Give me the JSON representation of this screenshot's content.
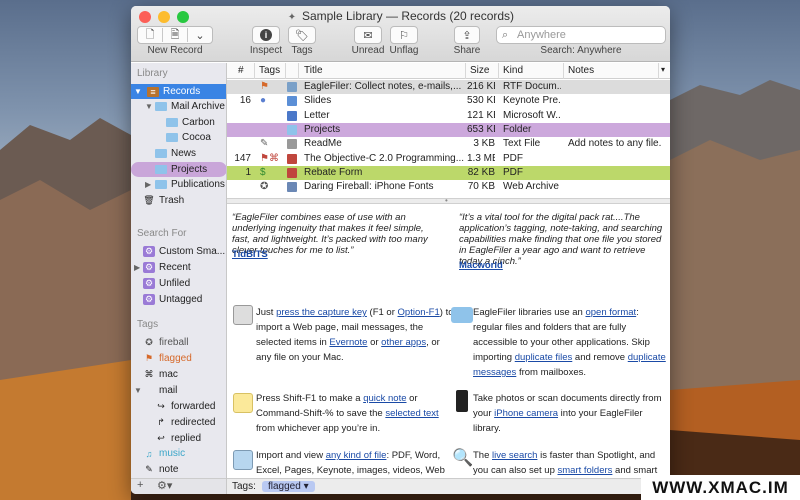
{
  "window": {
    "title": "Sample Library — Records (20 records)"
  },
  "toolbar": {
    "new_record_label": "New Record",
    "inspect_label": "Inspect",
    "tags_label": "Tags",
    "unread_label": "Unread",
    "unflag_label": "Unflag",
    "share_label": "Share",
    "search_placeholder": "Anywhere",
    "search_label": "Search: Anywhere"
  },
  "sidebar": {
    "library_header": "Library",
    "library_items": [
      {
        "label": "Records"
      },
      {
        "label": "Mail Archive"
      },
      {
        "label": "Carbon"
      },
      {
        "label": "Cocoa"
      },
      {
        "label": "News"
      },
      {
        "label": "Projects"
      },
      {
        "label": "Publications"
      },
      {
        "label": "Trash"
      }
    ],
    "search_header": "Search For",
    "search_items": [
      {
        "label": "Custom Sma..."
      },
      {
        "label": "Recent"
      },
      {
        "label": "Unfiled"
      },
      {
        "label": "Untagged"
      }
    ],
    "tags_header": "Tags",
    "tag_items": [
      {
        "label": "fireball"
      },
      {
        "label": "flagged"
      },
      {
        "label": "mac"
      },
      {
        "label": "mail"
      },
      {
        "label": "forwarded"
      },
      {
        "label": "redirected"
      },
      {
        "label": "replied"
      },
      {
        "label": "music"
      },
      {
        "label": "note"
      }
    ]
  },
  "table": {
    "columns": {
      "num": "#",
      "tags": "Tags",
      "title": "Title",
      "size": "Size",
      "kind": "Kind",
      "notes": "Notes"
    },
    "rows": [
      {
        "num": "",
        "tags": "⚑",
        "title": "EagleFiler: Collect notes, e-mails,...",
        "size": "216 KB",
        "kind": "RTF Docum...",
        "notes": ""
      },
      {
        "num": "16",
        "tags": "●",
        "title": "Slides",
        "size": "530 KB",
        "kind": "Keynote Pre...",
        "notes": ""
      },
      {
        "num": "",
        "tags": "",
        "title": "Letter",
        "size": "121 KB",
        "kind": "Microsoft W...",
        "notes": ""
      },
      {
        "num": "",
        "tags": "",
        "title": "Projects",
        "size": "653 KB",
        "kind": "Folder",
        "notes": ""
      },
      {
        "num": "",
        "tags": "✎",
        "title": "ReadMe",
        "size": "3 KB",
        "kind": "Text File",
        "notes": "Add notes to any file."
      },
      {
        "num": "147",
        "tags": "⚑⌘",
        "title": "The Objective-C 2.0 Programming...",
        "size": "1.3 MB",
        "kind": "PDF",
        "notes": ""
      },
      {
        "num": "1",
        "tags": "$",
        "title": "Rebate Form",
        "size": "82 KB",
        "kind": "PDF",
        "notes": ""
      },
      {
        "num": "",
        "tags": "✪",
        "title": "Daring Fireball: iPhone Fonts",
        "size": "70 KB",
        "kind": "Web Archive",
        "notes": ""
      }
    ]
  },
  "content": {
    "quote1": "“EagleFiler combines ease of use with an underlying ingenuity that makes it feel simple, fast, and lightweight. It’s packed with too many clever touches for me to list.”",
    "source1": "TidBITS",
    "quote2": "“It’s a vital tool for the digital pack rat....The application’s tagging, note-taking, and searching capabilities make finding that one file you stored in EagleFiler a year ago and want to retrieve today a cinch.”",
    "source2": "Macworld",
    "f1": {
      "a": "Just ",
      "l1": "press the capture key",
      "b": " (F1 or ",
      "l2": "Option-F1",
      "c": ") to import a Web page, mail messages, the selected items in ",
      "l3": "Evernote",
      "d": " or ",
      "l4": "other apps",
      "e": ", or any file on your Mac."
    },
    "f2": {
      "a": "EagleFiler libraries use an ",
      "l1": "open format",
      "b": ": regular files and folders that are fully accessible to your other applications. Skip importing ",
      "l2": "duplicate files",
      "c": " and remove ",
      "l3": "duplicate messages",
      "d": " from mailboxes."
    },
    "f3": {
      "a": "Press Shift-F1 to make a ",
      "l1": "quick note",
      "b": " or Command-Shift-% to save the ",
      "l2": "selected text",
      "c": " from whichever app you’re in."
    },
    "f4": {
      "a": "Take photos or scan documents directly from your ",
      "l1": "iPhone camera",
      "b": " into your EagleFiler library."
    },
    "f5": {
      "a": "Import and view ",
      "l1": "any kind of file",
      "b": ": PDF, Word, Excel, Pages, Keynote, images, videos, Web"
    },
    "f6": {
      "a": "The ",
      "l1": "live search",
      "b": " is faster than Spotlight, and you can also set up ",
      "l2": "smart folders",
      "c": " and smart folder"
    }
  },
  "footer": {
    "tags_label": "Tags:",
    "tag_value": "flagged"
  },
  "watermark": "WWW.XMAC.IM",
  "colors": {
    "selection_blue": "#3a84e4",
    "label_purple": "#cca8dc",
    "label_green": "#bcd86a",
    "link": "#1a4aa6"
  }
}
